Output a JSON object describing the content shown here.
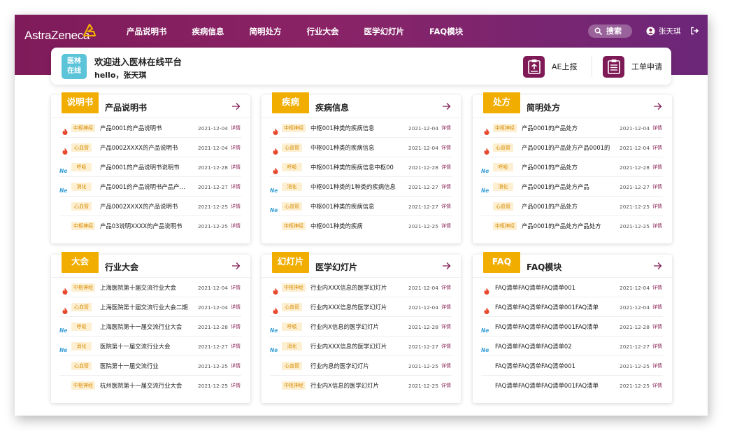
{
  "header": {
    "logo_text": "AstraZeneca",
    "nav": [
      "产品说明书",
      "疾病信息",
      "简明处方",
      "行业大会",
      "医学幻灯片",
      "FAQ模块"
    ],
    "search_label": "搜索",
    "user_name": "张天琪"
  },
  "welcome": {
    "icon_text": [
      "医林",
      "在线"
    ],
    "title": "欢迎进入医林在线平台",
    "subtitle": "hello，张天琪",
    "ae_label": "AE上报",
    "ticket_label": "工单申请"
  },
  "colors": {
    "brand": "#7e1a55",
    "accent": "#f1ae00",
    "tag_bg": "#fdf0d2",
    "tag_text": "#d88a00",
    "hot": "#e8482d",
    "new": "#3aa0d6"
  },
  "panels": [
    {
      "tag": "说明书",
      "title": "产品说明书",
      "rows": [
        {
          "icon": "hot",
          "cat": "中枢神经",
          "text": "产品0001的产品说明书",
          "date": "2021-12-04",
          "link": "详情"
        },
        {
          "icon": "hot",
          "cat": "心血管",
          "text": "产品0002XXXX的产品说明书",
          "date": "2021-12-04",
          "link": "详情"
        },
        {
          "icon": "new",
          "cat": "呼吸",
          "text": "产品0001的产品说明书说明书",
          "date": "2021-12-28",
          "link": "详情"
        },
        {
          "icon": "new",
          "cat": "消化",
          "text": "产品0001的产品说明书产品产…",
          "date": "2021-12-27",
          "link": "详情"
        },
        {
          "icon": "",
          "cat": "心血管",
          "text": "产品0002XXXX的产品说明书",
          "date": "2021-12-25",
          "link": "详情"
        },
        {
          "icon": "",
          "cat": "中枢神经",
          "text": "产品03说明XXXX的产品说明书",
          "date": "2021-12-25",
          "link": "详情"
        }
      ]
    },
    {
      "tag": "疾病",
      "title": "疾病信息",
      "rows": [
        {
          "icon": "hot",
          "cat": "中枢神经",
          "text": "中枢001种类的疾病信息",
          "date": "2021-12-04",
          "link": "详情"
        },
        {
          "icon": "hot",
          "cat": "心血管",
          "text": "中枢001种类的疾病信息",
          "date": "2021-12-04",
          "link": "详情"
        },
        {
          "icon": "hot",
          "cat": "呼吸",
          "text": "中枢001种类的疾病信息中枢00",
          "date": "2021-12-28",
          "link": "详情"
        },
        {
          "icon": "new",
          "cat": "消化",
          "text": "中枢001种类的1种类的疾病信息",
          "date": "2021-12-27",
          "link": "详情"
        },
        {
          "icon": "new",
          "cat": "心血管",
          "text": "中枢001种类的疾病信息",
          "date": "2021-12-27",
          "link": "详情"
        },
        {
          "icon": "",
          "cat": "中枢神经",
          "text": "中枢001种类的疾病",
          "date": "2021-12-25",
          "link": "详情"
        }
      ]
    },
    {
      "tag": "处方",
      "title": "简明处方",
      "rows": [
        {
          "icon": "hot",
          "cat": "中枢神经",
          "text": "产品0001的产品处方",
          "date": "2021-12-04",
          "link": "详情"
        },
        {
          "icon": "hot",
          "cat": "心血管",
          "text": "产品0001的产品处方产品0001的",
          "date": "2021-12-04",
          "link": "详情"
        },
        {
          "icon": "new",
          "cat": "呼吸",
          "text": "产品0001的产品处方",
          "date": "2021-12-28",
          "link": "详情"
        },
        {
          "icon": "new",
          "cat": "消化",
          "text": "产品0001的产品处方产品",
          "date": "2021-12-27",
          "link": "详情"
        },
        {
          "icon": "",
          "cat": "心血管",
          "text": "产品0001的产品处方",
          "date": "2021-12-25",
          "link": "详情"
        },
        {
          "icon": "",
          "cat": "中枢神经",
          "text": "产品0001的产品处方产品处方",
          "date": "2021-12-25",
          "link": "详情"
        }
      ]
    },
    {
      "tag": "大会",
      "title": "行业大会",
      "rows": [
        {
          "icon": "hot",
          "cat": "中枢神经",
          "text": "上海医院第十届交流行业大会",
          "date": "2021-12-04",
          "link": "详情"
        },
        {
          "icon": "hot",
          "cat": "心血管",
          "text": "上海医院第十届交流行业大会二期",
          "date": "2021-12-04",
          "link": "详情"
        },
        {
          "icon": "new",
          "cat": "呼吸",
          "text": "上海医院第十一届交流行业大会",
          "date": "2021-12-28",
          "link": "详情"
        },
        {
          "icon": "new",
          "cat": "消化",
          "text": "医院第十一届交流行业大会",
          "date": "2021-12-27",
          "link": "详情"
        },
        {
          "icon": "",
          "cat": "心血管",
          "text": "医院第十一届交流行业",
          "date": "2021-12-25",
          "link": "详情"
        },
        {
          "icon": "",
          "cat": "中枢神经",
          "text": "杭州医院第十一届交流行业大会",
          "date": "2021-12-25",
          "link": "详情"
        }
      ]
    },
    {
      "tag": "幻灯片",
      "title": "医学幻灯片",
      "rows": [
        {
          "icon": "hot",
          "cat": "中枢神经",
          "text": "行业内XXX信息的医学幻灯片",
          "date": "2021-12-04",
          "link": "详情"
        },
        {
          "icon": "hot",
          "cat": "心血管",
          "text": "行业内XXX信息的医学幻灯片",
          "date": "2021-12-04",
          "link": "详情"
        },
        {
          "icon": "new",
          "cat": "呼吸",
          "text": "行业内X信息的医学幻灯片",
          "date": "2021-12-28",
          "link": "详情"
        },
        {
          "icon": "new",
          "cat": "消化",
          "text": "行业内XXX信息的医学幻灯片",
          "date": "2021-12-27",
          "link": "详情"
        },
        {
          "icon": "",
          "cat": "心血管",
          "text": "行业内息的医学幻灯片",
          "date": "2021-12-25",
          "link": "详情"
        },
        {
          "icon": "",
          "cat": "中枢神经",
          "text": "行业内X信息的医学幻灯片",
          "date": "2021-12-25",
          "link": "详情"
        }
      ]
    },
    {
      "tag": "FAQ",
      "title": "FAQ模块",
      "rows": [
        {
          "icon": "hot",
          "cat": "",
          "text": "FAQ清单FAQ清单FAQ清单001",
          "date": "2021-12-04",
          "link": "详情"
        },
        {
          "icon": "hot",
          "cat": "",
          "text": "FAQ清单FAQ清单FAQ清单001FAQ清单",
          "date": "2021-12-04",
          "link": "详情"
        },
        {
          "icon": "new",
          "cat": "",
          "text": "FAQ清单FAQ清单FAQ清单001FAQ清单",
          "date": "2021-12-28",
          "link": "详情"
        },
        {
          "icon": "new",
          "cat": "",
          "text": "FAQ清单FAQ清单FAQ清单02",
          "date": "2021-12-27",
          "link": "详情"
        },
        {
          "icon": "",
          "cat": "",
          "text": "FAQ清单FAQ清单FAQ清单001",
          "date": "2021-12-25",
          "link": "详情"
        },
        {
          "icon": "",
          "cat": "",
          "text": "FAQ清单FAQ清单FAQ清单001FAQ清单",
          "date": "2021-12-25",
          "link": "详情"
        }
      ]
    }
  ]
}
